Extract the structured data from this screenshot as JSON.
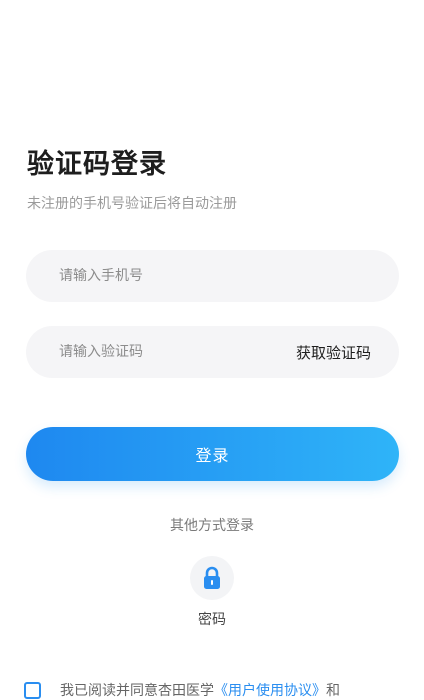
{
  "header": {
    "title": "验证码登录",
    "subtitle": "未注册的手机号验证后将自动注册"
  },
  "form": {
    "phone_placeholder": "请输入手机号",
    "code_placeholder": "请输入验证码",
    "get_code_label": "获取验证码",
    "login_label": "登录"
  },
  "other_login": {
    "label": "其他方式登录",
    "methods": [
      {
        "label": "密码",
        "icon": "lock-icon"
      }
    ]
  },
  "agreement": {
    "checked": false,
    "prefix": "我已阅读并同意杏田医学",
    "link": "《用户使用协议》",
    "suffix": "和"
  },
  "colors": {
    "accent": "#2a8ef0",
    "button_gradient_start": "#1e88f0",
    "button_gradient_end": "#2fb4f8",
    "input_bg": "#f5f5f7"
  }
}
